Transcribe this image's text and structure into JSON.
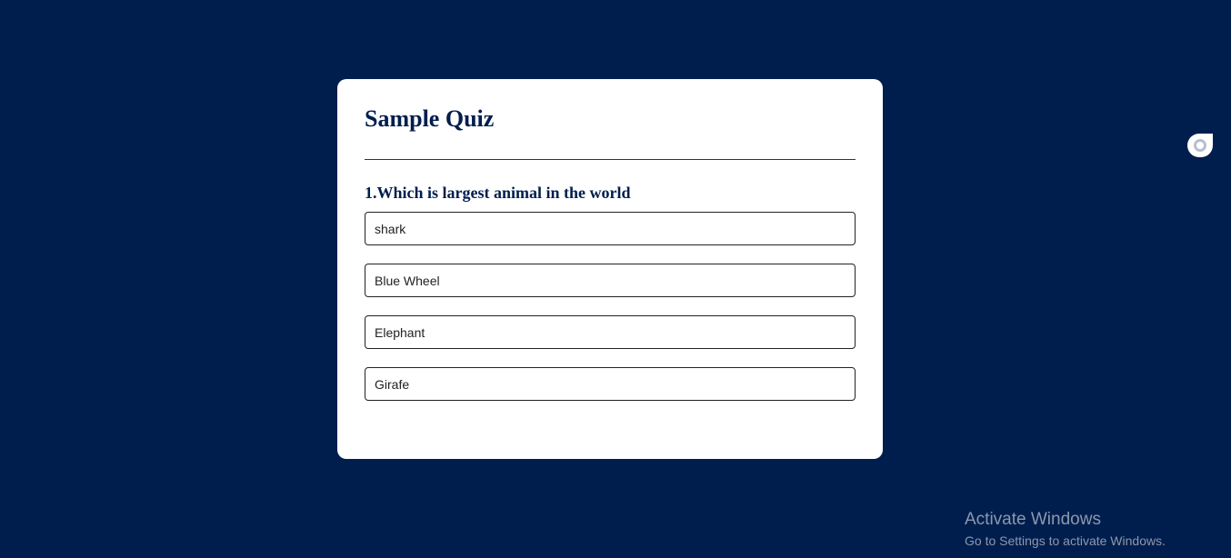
{
  "quiz": {
    "title": "Sample Quiz",
    "question": "1.Which is largest animal in the world",
    "answers": [
      "shark",
      "Blue Wheel",
      "Elephant",
      "Girafe"
    ]
  },
  "side_widget": {
    "icon": "circle-icon"
  },
  "watermark": {
    "title": "Activate Windows",
    "subtitle": "Go to Settings to activate Windows."
  },
  "colors": {
    "background": "#001e4d",
    "card": "#ffffff",
    "title_text": "#001e4d"
  }
}
